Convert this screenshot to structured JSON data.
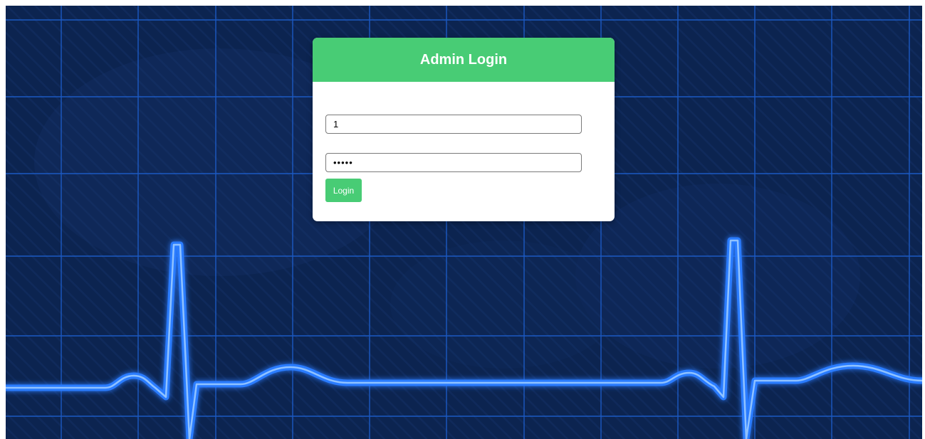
{
  "login": {
    "title": "Admin Login",
    "username_value": "1",
    "password_value": "12345",
    "button_label": "Login"
  },
  "colors": {
    "accent": "#48cc75",
    "background": "#0c2450",
    "grid": "#1f6fe0",
    "ecg_line": "#3a8bff"
  },
  "background": {
    "description_icon": "ecg-heartbeat-grid"
  }
}
